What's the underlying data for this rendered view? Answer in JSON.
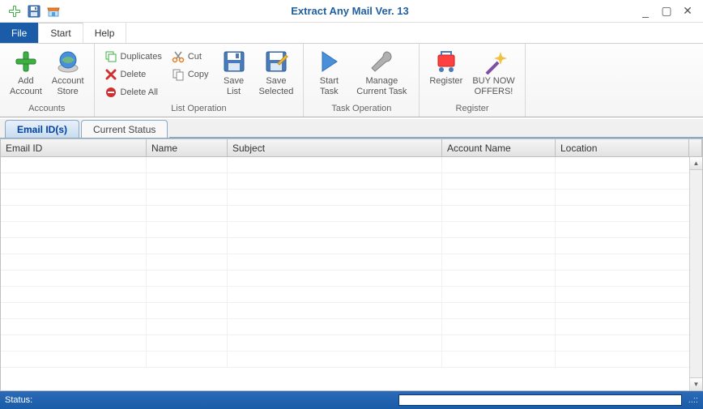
{
  "titlebar": {
    "title": "Extract Any Mail Ver. 13",
    "icons": {
      "add": "add-icon",
      "save": "save-icon",
      "store": "store-icon"
    },
    "win": {
      "min": "_",
      "max": "▢",
      "close": "✕"
    }
  },
  "menu": {
    "file": "File",
    "start": "Start",
    "help": "Help"
  },
  "ribbon": {
    "accounts": {
      "label": "Accounts",
      "add_account": "Add\nAccount",
      "account_store": "Account\nStore"
    },
    "list_op": {
      "label": "List Operation",
      "duplicates": "Duplicates",
      "delete": "Delete",
      "delete_all": "Delete All",
      "cut": "Cut",
      "copy": "Copy",
      "save_list": "Save\nList",
      "save_selected": "Save\nSelected"
    },
    "task_op": {
      "label": "Task Operation",
      "start_task": "Start\nTask",
      "manage_task": "Manage\nCurrent Task"
    },
    "register": {
      "label": "Register",
      "register": "Register",
      "buy_now": "BUY NOW\nOFFERS!"
    }
  },
  "tabs": {
    "email_ids": "Email ID(s)",
    "current_status": "Current Status"
  },
  "columns": {
    "email_id": "Email ID",
    "name": "Name",
    "subject": "Subject",
    "account": "Account Name",
    "location": "Location"
  },
  "rows": [],
  "status": {
    "label": "Status:",
    "value": ""
  }
}
